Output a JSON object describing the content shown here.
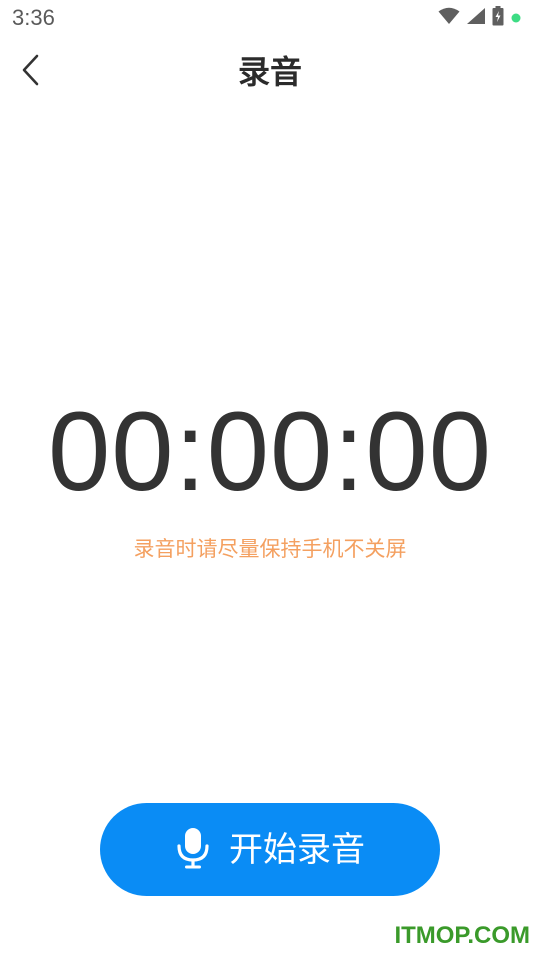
{
  "status_bar": {
    "time": "3:36",
    "icons": [
      "wifi-icon",
      "signal-icon",
      "battery-charging-icon",
      "notification-dot-icon"
    ],
    "dot_color": "#3ddc84"
  },
  "header": {
    "back_icon": "chevron-left-icon",
    "title": "录音"
  },
  "timer": {
    "value": "00:00:00"
  },
  "hint": {
    "text": "录音时请尽量保持手机不关屏",
    "color": "#f4a060"
  },
  "record_button": {
    "icon": "microphone-icon",
    "label": "开始录音",
    "color": "#0a8cf5"
  },
  "watermark": {
    "text": "ITMOP.COM"
  }
}
